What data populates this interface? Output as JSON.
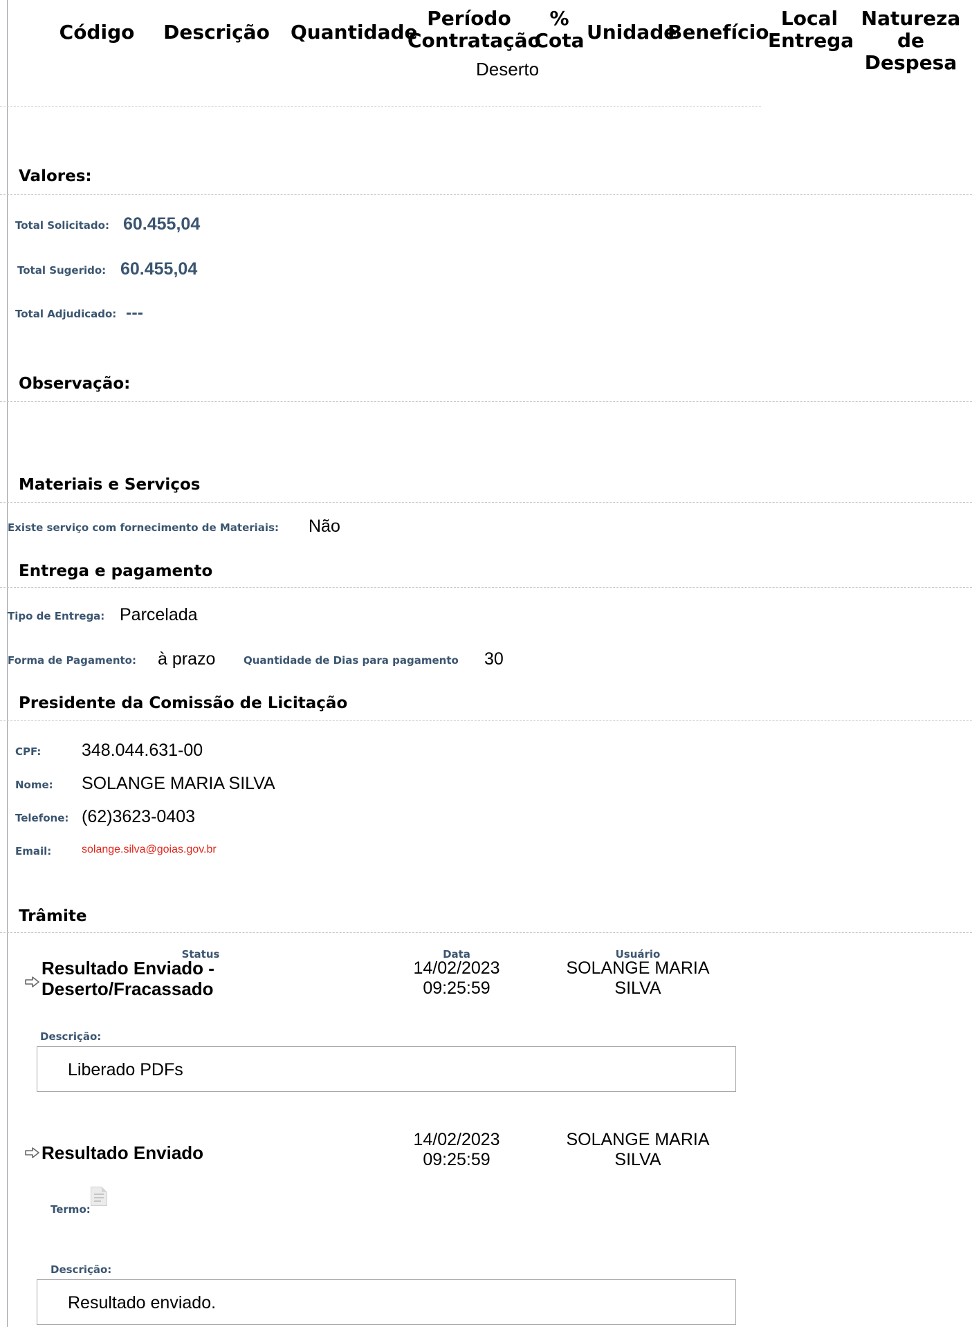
{
  "table": {
    "headers": {
      "codigo": "Código",
      "descricao": "Descrição",
      "quantidade": "Quantidade",
      "periodo_line1": "Período",
      "periodo_line2": "Contratação",
      "cota_line1": "%",
      "cota_line2": "Cota",
      "unidade": "Unidade",
      "beneficio": "Benefício",
      "local_line1": "Local",
      "local_line2": "Entrega",
      "natureza_line1": "Natureza",
      "natureza_line2": "de Despesa"
    },
    "status_cell": "Deserto"
  },
  "valores": {
    "title": "Valores:",
    "total_solicitado_label": "Total Solicitado:",
    "total_solicitado_value": "60.455,04",
    "total_sugerido_label": "Total Sugerido:",
    "total_sugerido_value": "60.455,04",
    "total_adjudicado_label": "Total Adjudicado:",
    "total_adjudicado_value": "---"
  },
  "observacao": {
    "title": "Observação:"
  },
  "materiais": {
    "title": "Materiais e Serviços",
    "label": "Existe serviço com fornecimento de Materiais:",
    "value": "Não"
  },
  "entrega": {
    "title": "Entrega e pagamento",
    "tipo_label": "Tipo de Entrega:",
    "tipo_value": "Parcelada",
    "forma_label": "Forma de Pagamento:",
    "forma_value": "à prazo",
    "dias_label": "Quantidade de Dias para pagamento",
    "dias_value": "30"
  },
  "presidente": {
    "title": "Presidente da Comissão de Licitação",
    "cpf_label": "CPF:",
    "cpf_value": "348.044.631-00",
    "nome_label": "Nome:",
    "nome_value": "SOLANGE MARIA SILVA",
    "telefone_label": "Telefone:",
    "telefone_value": "(62)3623-0403",
    "email_label": "Email:",
    "email_value": "solange.silva@goias.gov.br"
  },
  "tramite": {
    "title": "Trâmite",
    "col_status": "Status",
    "col_data": "Data",
    "col_usuario": "Usuário",
    "entries": [
      {
        "status_line1": "Resultado Enviado -",
        "status_line2": "Deserto/Fracassado",
        "date": "14/02/2023",
        "time": "09:25:59",
        "user_line1": "SOLANGE MARIA",
        "user_line2": "SILVA",
        "descricao_label": "Descrição:",
        "descricao": "Liberado PDFs"
      },
      {
        "status_line1": "Resultado Enviado",
        "date": "14/02/2023",
        "time": "09:25:59",
        "user_line1": "SOLANGE MARIA",
        "user_line2": "SILVA",
        "termo_label": "Termo:",
        "descricao_label": "Descrição:",
        "descricao": "Resultado enviado."
      }
    ]
  },
  "colors": {
    "label": "#3b5570",
    "email": "#e0261b",
    "divider": "#c8c8c8"
  },
  "icons": {
    "tramite_row": "arrow-right-icon",
    "termo": "document-icon"
  }
}
